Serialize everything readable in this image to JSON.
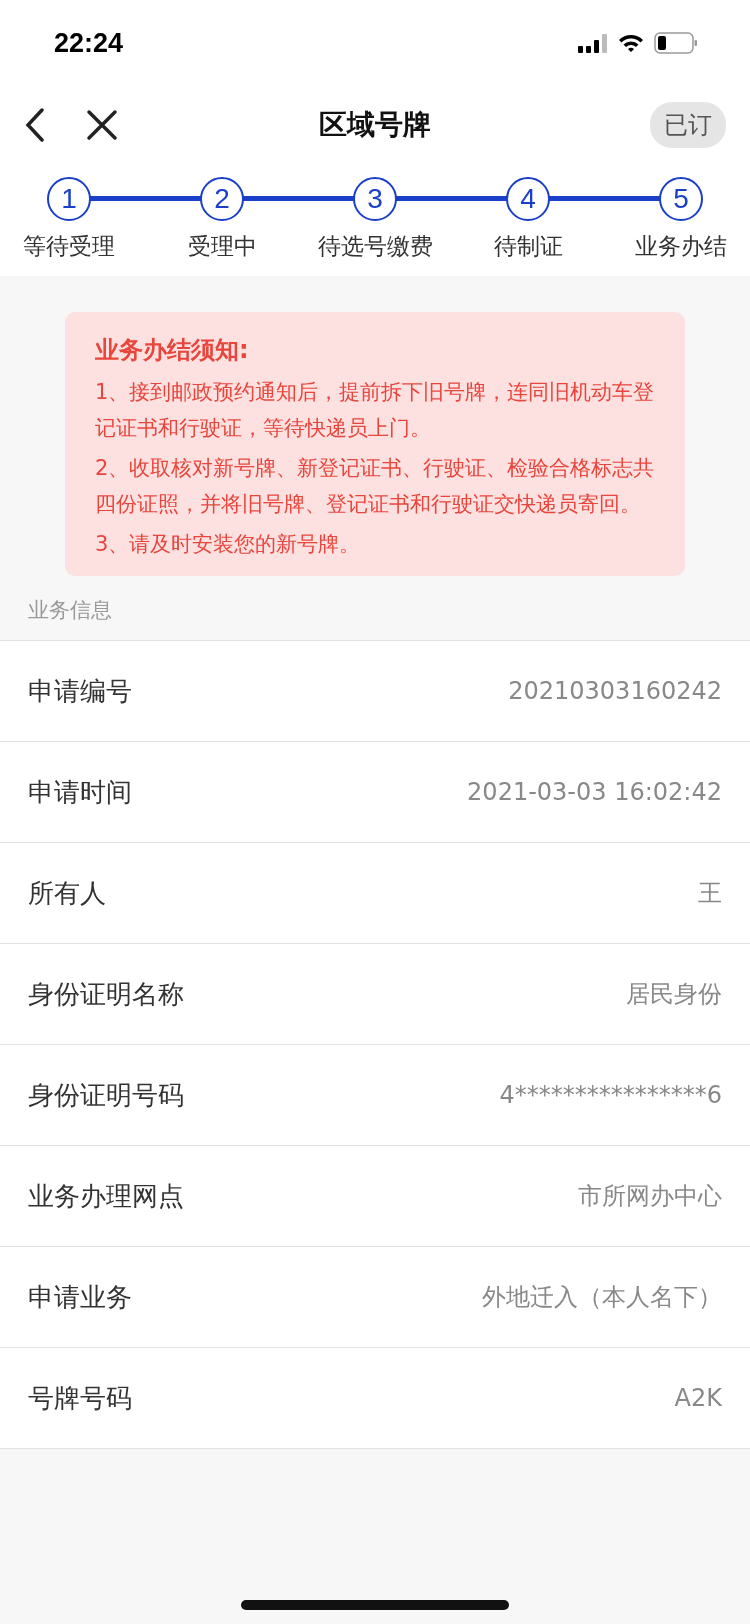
{
  "status_bar": {
    "time": "22:24"
  },
  "nav": {
    "title": "区域号牌",
    "action": "已订"
  },
  "steps": [
    {
      "number": "1",
      "label": "等待受理"
    },
    {
      "number": "2",
      "label": "受理中"
    },
    {
      "number": "3",
      "label": "待选号缴费"
    },
    {
      "number": "4",
      "label": "待制证"
    },
    {
      "number": "5",
      "label": "业务办结"
    }
  ],
  "notice": {
    "title": "业务办结须知:",
    "items": [
      "1、接到邮政预约通知后，提前拆下旧号牌，连同旧机动车登记证书和行驶证，等待快递员上门。",
      "2、收取核对新号牌、新登记证书、行驶证、检验合格标志共四份证照，并将旧号牌、登记证书和行驶证交快递员寄回。",
      "3、请及时安装您的新号牌。"
    ]
  },
  "section_title": "业务信息",
  "fields": [
    {
      "label": "申请编号",
      "value": "20210303160242"
    },
    {
      "label": "申请时间",
      "value": "2021-03-03 16:02:42"
    },
    {
      "label": "所有人",
      "value": "王"
    },
    {
      "label": "身份证明名称",
      "value": "居民身份"
    },
    {
      "label": "身份证明号码",
      "value": "4****************6"
    },
    {
      "label": "业务办理网点",
      "value": "市所网办中心"
    },
    {
      "label": "申请业务",
      "value": "外地迁入（本人名下）"
    },
    {
      "label": "号牌号码",
      "value": "A2K"
    }
  ]
}
